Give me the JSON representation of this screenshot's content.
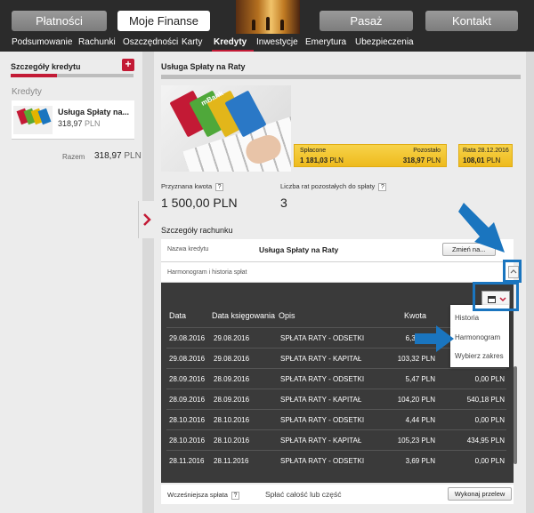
{
  "top_nav": {
    "items": [
      {
        "label": "Płatności",
        "active": false
      },
      {
        "label": "Moje Finanse",
        "active": true
      },
      {
        "label": "Pasaż",
        "active": false
      },
      {
        "label": "Kontakt",
        "active": false
      }
    ]
  },
  "sub_nav": {
    "items": [
      "Podsumowanie",
      "Rachunki",
      "Oszczędności",
      "Karty",
      "Kredyty",
      "Inwestycje",
      "Emerytura",
      "Ubezpieczenia"
    ],
    "active": "Kredyty"
  },
  "sidebar": {
    "title": "Szczegóły kredytu",
    "add_label": "+",
    "section_label": "Kredyty",
    "loan": {
      "name": "Usługa Spłaty na...",
      "amount": "318,97",
      "currency": "PLN"
    },
    "total_label": "Razem",
    "total_amount": "318,97",
    "total_currency": "PLN"
  },
  "main": {
    "title": "Usługa Spłaty na Raty",
    "photo_brand": "mBank",
    "summary": {
      "splacone_label": "Spłacone",
      "splacone_value": "1 181,03",
      "pozostalo_label": "Pozostało",
      "pozostalo_value": "318,97",
      "rata_label": "Rata 28.12.2016",
      "rata_value": "108,01",
      "currency": "PLN"
    },
    "granted_label": "Przyznana kwota",
    "granted_value": "1 500,00 PLN",
    "remaining_installments_label": "Liczba rat pozostałych do spłaty",
    "remaining_installments_value": "3",
    "help_glyph": "?",
    "account_section_label": "Szczegóły rachunku",
    "credit_name_label": "Nazwa kredytu",
    "credit_name_value": "Usługa Spłaty na Raty",
    "change_button_label": "Zmień na...",
    "schedule_label": "Harmonogram i historia spłat"
  },
  "table": {
    "headers": {
      "date": "Data",
      "booking_date": "Data księgowania",
      "description": "Opis",
      "amount": "Kwota"
    },
    "rows": [
      {
        "date": "29.08.2016",
        "booking_date": "29.08.2016",
        "description": "SPŁATA RATY - ODSETKI",
        "amount": "6,35 PLN",
        "balance": ""
      },
      {
        "date": "29.08.2016",
        "booking_date": "29.08.2016",
        "description": "SPŁATA RATY - KAPITAŁ",
        "amount": "103,32 PLN",
        "balance": ""
      },
      {
        "date": "28.09.2016",
        "booking_date": "28.09.2016",
        "description": "SPŁATA RATY - ODSETKI",
        "amount": "5,47 PLN",
        "balance": "0,00 PLN"
      },
      {
        "date": "28.09.2016",
        "booking_date": "28.09.2016",
        "description": "SPŁATA RATY - KAPITAŁ",
        "amount": "104,20 PLN",
        "balance": "540,18 PLN"
      },
      {
        "date": "28.10.2016",
        "booking_date": "28.10.2016",
        "description": "SPŁATA RATY - ODSETKI",
        "amount": "4,44 PLN",
        "balance": "0,00 PLN"
      },
      {
        "date": "28.10.2016",
        "booking_date": "28.10.2016",
        "description": "SPŁATA RATY - KAPITAŁ",
        "amount": "105,23 PLN",
        "balance": "434,95 PLN"
      },
      {
        "date": "28.11.2016",
        "booking_date": "28.11.2016",
        "description": "SPŁATA RATY - ODSETKI",
        "amount": "3,69 PLN",
        "balance": "0,00 PLN"
      }
    ],
    "dropdown_options": [
      "Historia",
      "Harmonogram",
      "Wybierz zakres"
    ]
  },
  "footer": {
    "early_repayment_label": "Wcześniejsza spłata",
    "repay_text": "Spłać całość lub część",
    "execute_button_label": "Wykonaj przelew"
  },
  "colors": {
    "accent": "#c31a35",
    "highlight": "#1a75bf",
    "yellow": "#f2c42c",
    "dark_nav": "#2b2b2b",
    "table_bg": "#3a3a3a"
  }
}
